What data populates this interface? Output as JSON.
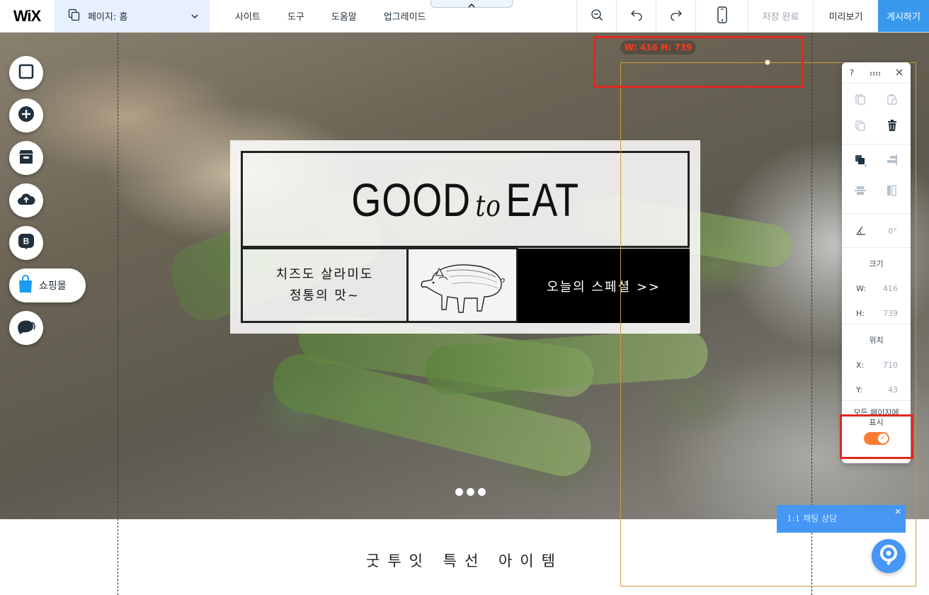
{
  "topbar": {
    "logo": "WiX",
    "page_selector": {
      "label": "페이지: 홈",
      "icon": "pages-icon"
    },
    "menu": [
      "사이트",
      "도구",
      "도움말",
      "업그레이드"
    ],
    "tools": [
      "zoom-out-icon",
      "undo-icon",
      "redo-icon",
      "mobile-icon"
    ],
    "save_status": "저장 완료",
    "preview_label": "미리보기",
    "publish_label": "게시하기"
  },
  "left_tools": {
    "items": [
      "background-icon",
      "add-icon",
      "app-market-icon",
      "upload-icon",
      "blog-icon"
    ],
    "shopping_label": "쇼핑몰",
    "chat_icon": "chat-icon"
  },
  "banner": {
    "title_left": "GOOD",
    "title_script": "to",
    "title_right": "EAT",
    "cell_line1": "치즈도 살라미도",
    "cell_line2": "정통의 맛~",
    "cta_label": "오늘의 스페셜 >>",
    "image_icon": "pig-illustration"
  },
  "slideshow": {
    "dots": 3
  },
  "section_title": "굿투잇 특선 아이템",
  "selection": {
    "size_tag": "W: 416 H: 739"
  },
  "panel": {
    "help": "?",
    "size_label": "크기",
    "w_label": "W:",
    "w_value": "416",
    "h_label": "H:",
    "h_value": "739",
    "position_label": "위치",
    "x_label": "X:",
    "x_value": "710",
    "y_label": "Y:",
    "y_value": "43",
    "angle_value": "0°",
    "show_all_line1": "모든 페이지에",
    "show_all_line2": "표시",
    "show_all_enabled": true
  },
  "chat": {
    "bubble_text": "1:1 채팅 상담",
    "close": "×"
  },
  "colors": {
    "accent": "#3899ec",
    "toggle": "#fb7d33",
    "highlight": "#e0281e",
    "selection": "#d19a3a",
    "chat": "#4596f5"
  }
}
